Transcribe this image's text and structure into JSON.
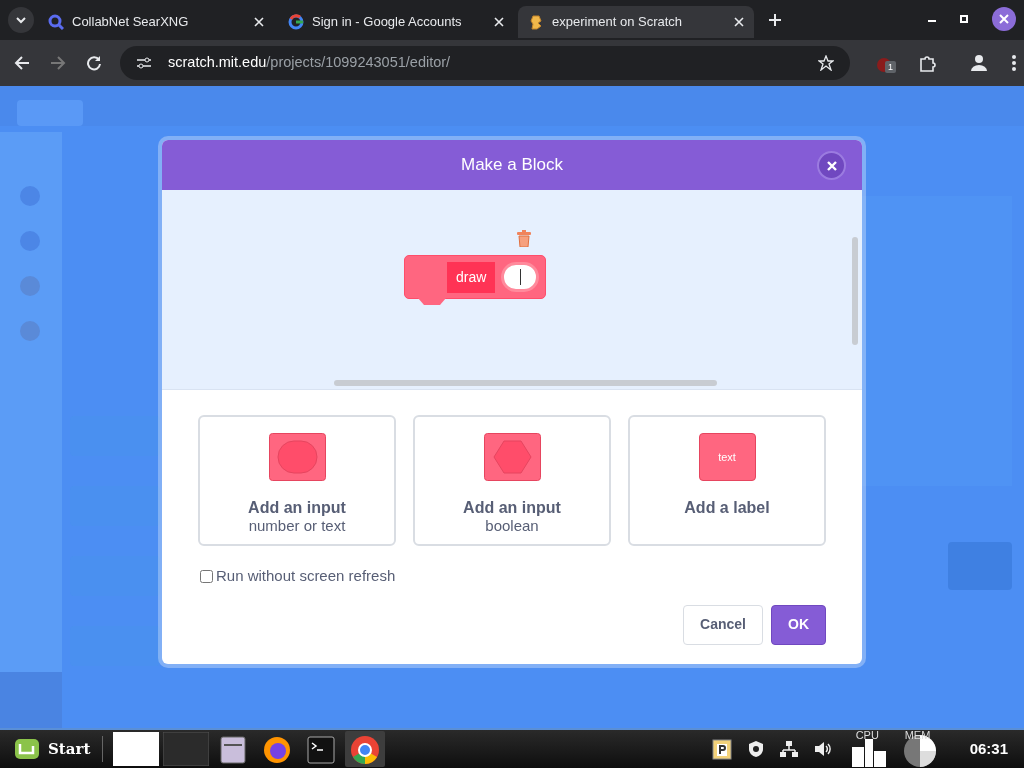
{
  "browser": {
    "tabs": [
      {
        "title": "CollabNet SearXNG",
        "kind": "search",
        "selected": false
      },
      {
        "title": "Sign in - Google Accounts",
        "kind": "google",
        "selected": false
      },
      {
        "title": "experiment on Scratch",
        "kind": "scratch",
        "selected": true
      }
    ],
    "url": {
      "host": "scratch.mit.edu",
      "path": "/projects/1099243051/editor/"
    },
    "extension_badge": "1"
  },
  "dialog": {
    "title": "Make a Block",
    "block": {
      "label": "draw"
    },
    "options": [
      {
        "kind": "input-round",
        "title": "Add an input",
        "subtitle": "number or text"
      },
      {
        "kind": "input-diamond",
        "title": "Add an input",
        "subtitle": "boolean"
      },
      {
        "kind": "label",
        "title": "Add a label",
        "chip": "text"
      }
    ],
    "checkbox": {
      "label": "Run without screen refresh",
      "checked": false
    },
    "buttons": [
      {
        "label": "Cancel",
        "kind": "secondary"
      },
      {
        "label": "OK",
        "kind": "primary"
      }
    ]
  },
  "taskbar": {
    "start": "Start",
    "apps": [
      {
        "kind": "window-light",
        "active": false
      },
      {
        "kind": "window-dark",
        "active": false
      },
      {
        "kind": "files",
        "active": false
      },
      {
        "kind": "firefox",
        "active": false
      },
      {
        "kind": "terminal",
        "active": false
      },
      {
        "kind": "chrome",
        "active": true
      }
    ],
    "cpu": "CPU",
    "mem": "MEM",
    "clock": "06:31"
  }
}
